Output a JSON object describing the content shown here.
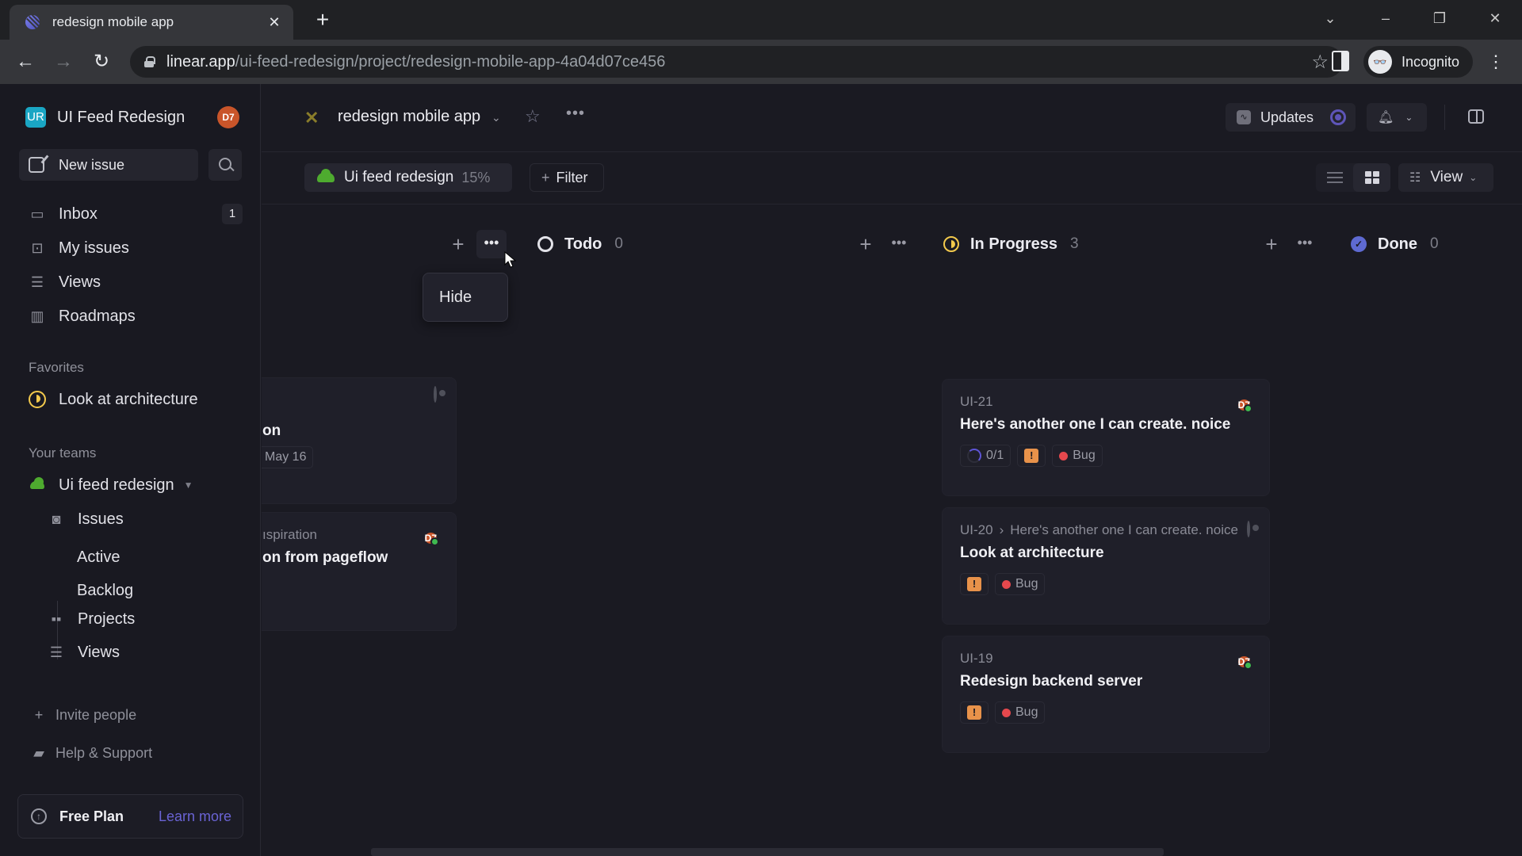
{
  "browser": {
    "tab_title": "redesign mobile app",
    "url_host": "linear.app",
    "url_path": "/ui-feed-redesign/project/redesign-mobile-app-4a04d07ce456",
    "profile_label": "Incognito"
  },
  "sidebar": {
    "workspace_logo": "UR",
    "workspace_name": "UI Feed Redesign",
    "user_initials": "D7",
    "new_issue_label": "New issue",
    "nav": [
      {
        "label": "Inbox",
        "icon": "inbox-icon",
        "badge": "1"
      },
      {
        "label": "My issues",
        "icon": "my-issues-icon"
      },
      {
        "label": "Views",
        "icon": "views-icon"
      },
      {
        "label": "Roadmaps",
        "icon": "roadmap-icon"
      }
    ],
    "favorites_title": "Favorites",
    "favorites": [
      {
        "label": "Look at architecture",
        "icon": "in-progress-icon"
      }
    ],
    "teams_title": "Your teams",
    "team": {
      "name": "Ui feed redesign",
      "items": [
        {
          "label": "Issues"
        },
        {
          "label": "Active"
        },
        {
          "label": "Backlog"
        },
        {
          "label": "Projects"
        },
        {
          "label": "Views"
        }
      ]
    },
    "invite_label": "Invite people",
    "help_label": "Help & Support",
    "plan_label": "Free Plan",
    "plan_link": "Learn more"
  },
  "header": {
    "project_title": "redesign mobile app",
    "updates_label": "Updates",
    "team_chip_label": "Ui feed redesign",
    "team_chip_progress": "15%",
    "filter_label": "Filter",
    "view_label": "View"
  },
  "board": {
    "hidden_column_menu": {
      "item": "Hide"
    },
    "partial_cards": [
      {
        "title_fragment": "on",
        "date": "May 16"
      },
      {
        "parent_fragment": "ıspiration",
        "title_fragment": "on from pageflow",
        "assignee": "D7"
      }
    ],
    "columns": [
      {
        "name": "Todo",
        "count": "0",
        "status": "todo",
        "cards": []
      },
      {
        "name": "In Progress",
        "count": "3",
        "status": "in-progress",
        "cards": [
          {
            "id": "UI-21",
            "parent": "",
            "title": "Here's another one I can create. noice",
            "subissues": "0/1",
            "priority": "!",
            "label": "Bug",
            "assignee": "D7"
          },
          {
            "id": "UI-20",
            "parent": "Here's another one I can create. noice",
            "title": "Look at architecture",
            "priority": "!",
            "label": "Bug",
            "assignee": ""
          },
          {
            "id": "UI-19",
            "parent": "",
            "title": "Redesign backend server",
            "priority": "!",
            "label": "Bug",
            "assignee": "D7"
          }
        ]
      },
      {
        "name": "Done",
        "count": "0",
        "status": "done",
        "cards": []
      }
    ]
  },
  "colors": {
    "accent": "#5e6ad2",
    "in_progress": "#f2c94c",
    "bug_label": "#e5484d",
    "priority_urgent": "#e8924a",
    "team_green": "#4eab2f",
    "avatar": "#c9552a"
  }
}
